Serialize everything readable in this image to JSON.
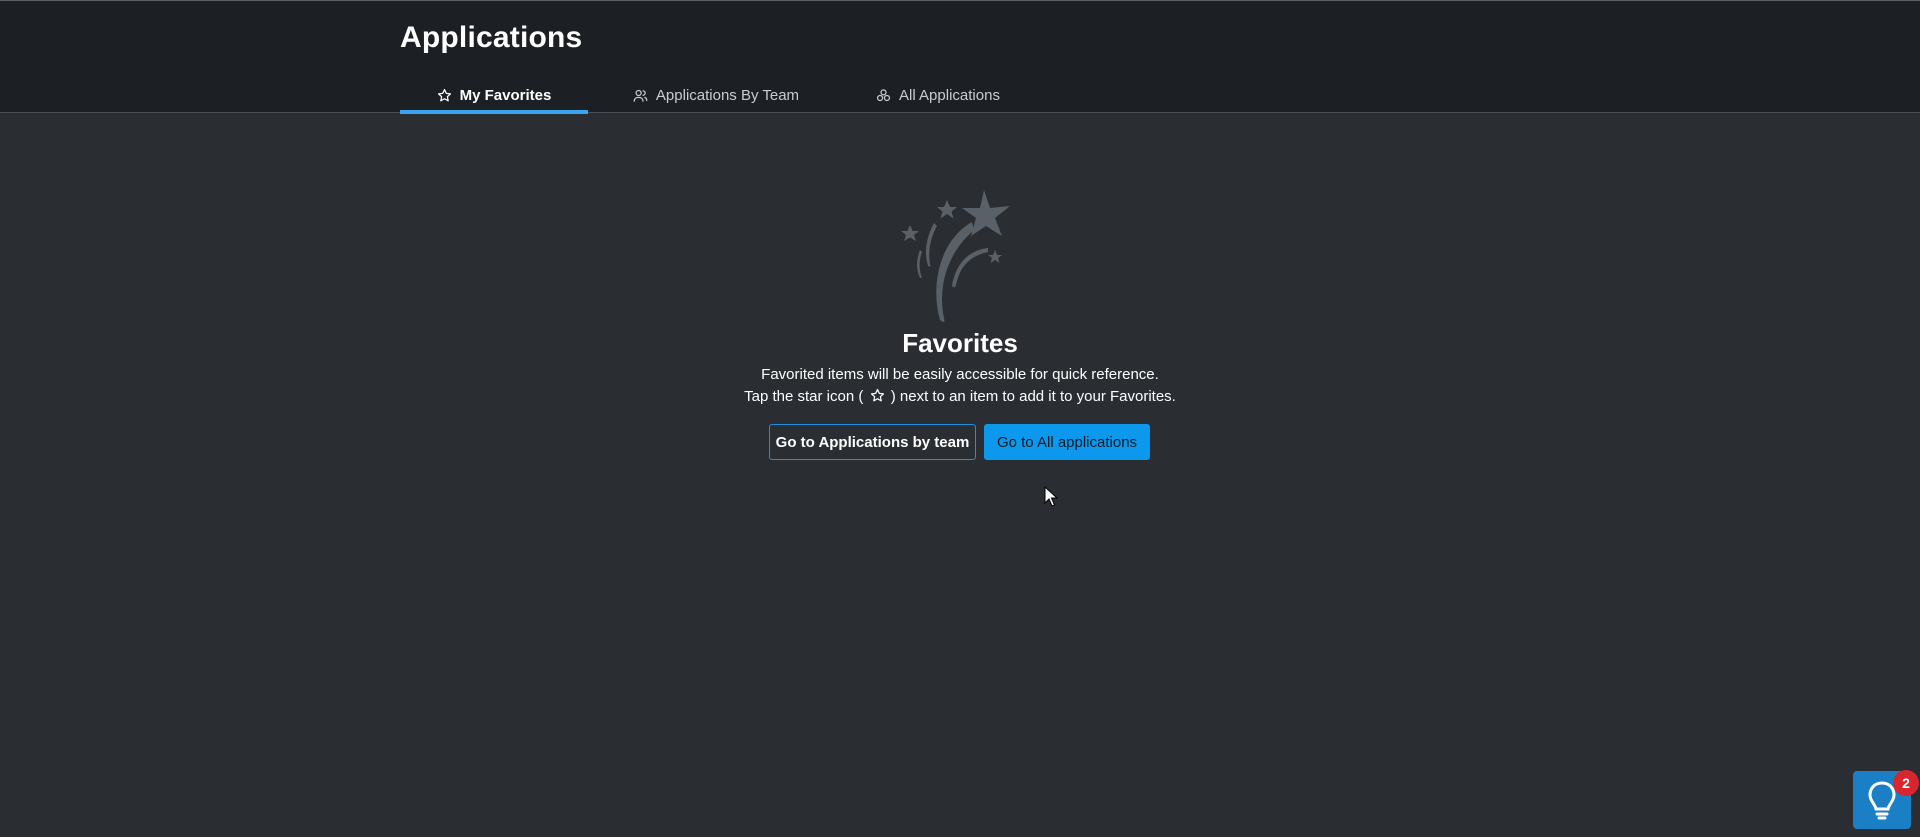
{
  "header": {
    "title": "Applications",
    "tabs": [
      {
        "label": "My Favorites",
        "icon": "star-outline-icon",
        "active": true
      },
      {
        "label": "Applications By Team",
        "icon": "team-icon",
        "active": false
      },
      {
        "label": "All Applications",
        "icon": "apps-grid-icon",
        "active": false
      }
    ]
  },
  "empty_state": {
    "illustration": "shooting-stars-icon",
    "title": "Favorites",
    "line1": "Favorited items will be easily accessible for quick reference.",
    "line2_before": "Tap the star icon (",
    "line2_after": ") next to an item to add it to your Favorites.",
    "buttons": {
      "by_team": "Go to Applications by team",
      "all": "Go to All applications"
    }
  },
  "help_widget": {
    "icon": "lightbulb-icon",
    "badge_count": "2"
  },
  "colors": {
    "header_bg": "#1c1f23",
    "page_bg": "#2a2e33",
    "accent": "#3ba5ee",
    "primary_button": "#0c98ec",
    "badge": "#d7262e"
  }
}
